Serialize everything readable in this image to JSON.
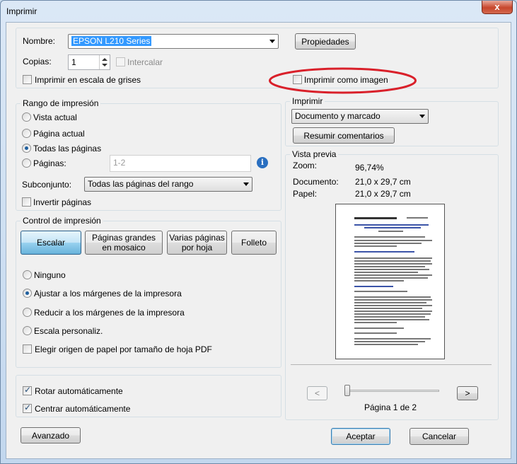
{
  "window": {
    "title": "Imprimir",
    "close_glyph": "x"
  },
  "printer": {
    "name_label": "Nombre:",
    "name_value": "EPSON L210 Series",
    "properties_label": "Propiedades",
    "copies_label": "Copias:",
    "copies_value": "1",
    "collate_label": "Intercalar",
    "grayscale_label": "Imprimir en escala de grises",
    "as_image_label": "Imprimir como imagen"
  },
  "range": {
    "group_label": "Rango de impresión",
    "current_view": "Vista actual",
    "current_page": "Página actual",
    "all_pages": "Todas las páginas",
    "pages_label": "Páginas:",
    "pages_value": "1-2",
    "subset_label": "Subconjunto:",
    "subset_value": "Todas las páginas del rango",
    "reverse_label": "Invertir páginas",
    "info_glyph": "i"
  },
  "control": {
    "group_label": "Control de impresión",
    "scale_button": "Escalar",
    "tile_button_line1": "Páginas grandes",
    "tile_button_line2": "en mosaico",
    "multiple_button_line1": "Varias páginas",
    "multiple_button_line2": "por hoja",
    "booklet_button": "Folleto",
    "none": "Ninguno",
    "fit": "Ajustar a los márgenes de la impresora",
    "reduce": "Reducir a los márgenes de la impresora",
    "custom": "Escala personaliz.",
    "paper_source": "Elegir origen de papel por tamaño de hoja PDF"
  },
  "auto": {
    "rotate": "Rotar automáticamente",
    "center": "Centrar automáticamente"
  },
  "print_what": {
    "group_label": "Imprimir",
    "value": "Documento y marcado",
    "summarize_button": "Resumir comentarios"
  },
  "preview": {
    "group_label": "Vista previa",
    "zoom_label": "Zoom:",
    "zoom_value": "96,74%",
    "doc_label": "Documento:",
    "doc_value": "21,0 x 29,7 cm",
    "paper_label": "Papel:",
    "paper_value": "21,0 x 29,7 cm",
    "prev_glyph": "<",
    "next_glyph": ">",
    "page_status": "Página 1 de 2",
    "slider_position": 0
  },
  "footer": {
    "advanced_button": "Avanzado",
    "accept_button": "Aceptar",
    "cancel_button": "Cancelar"
  },
  "colors": {
    "annotation_ellipse": "#d9202a",
    "info_icon": "#2a6fc0"
  }
}
